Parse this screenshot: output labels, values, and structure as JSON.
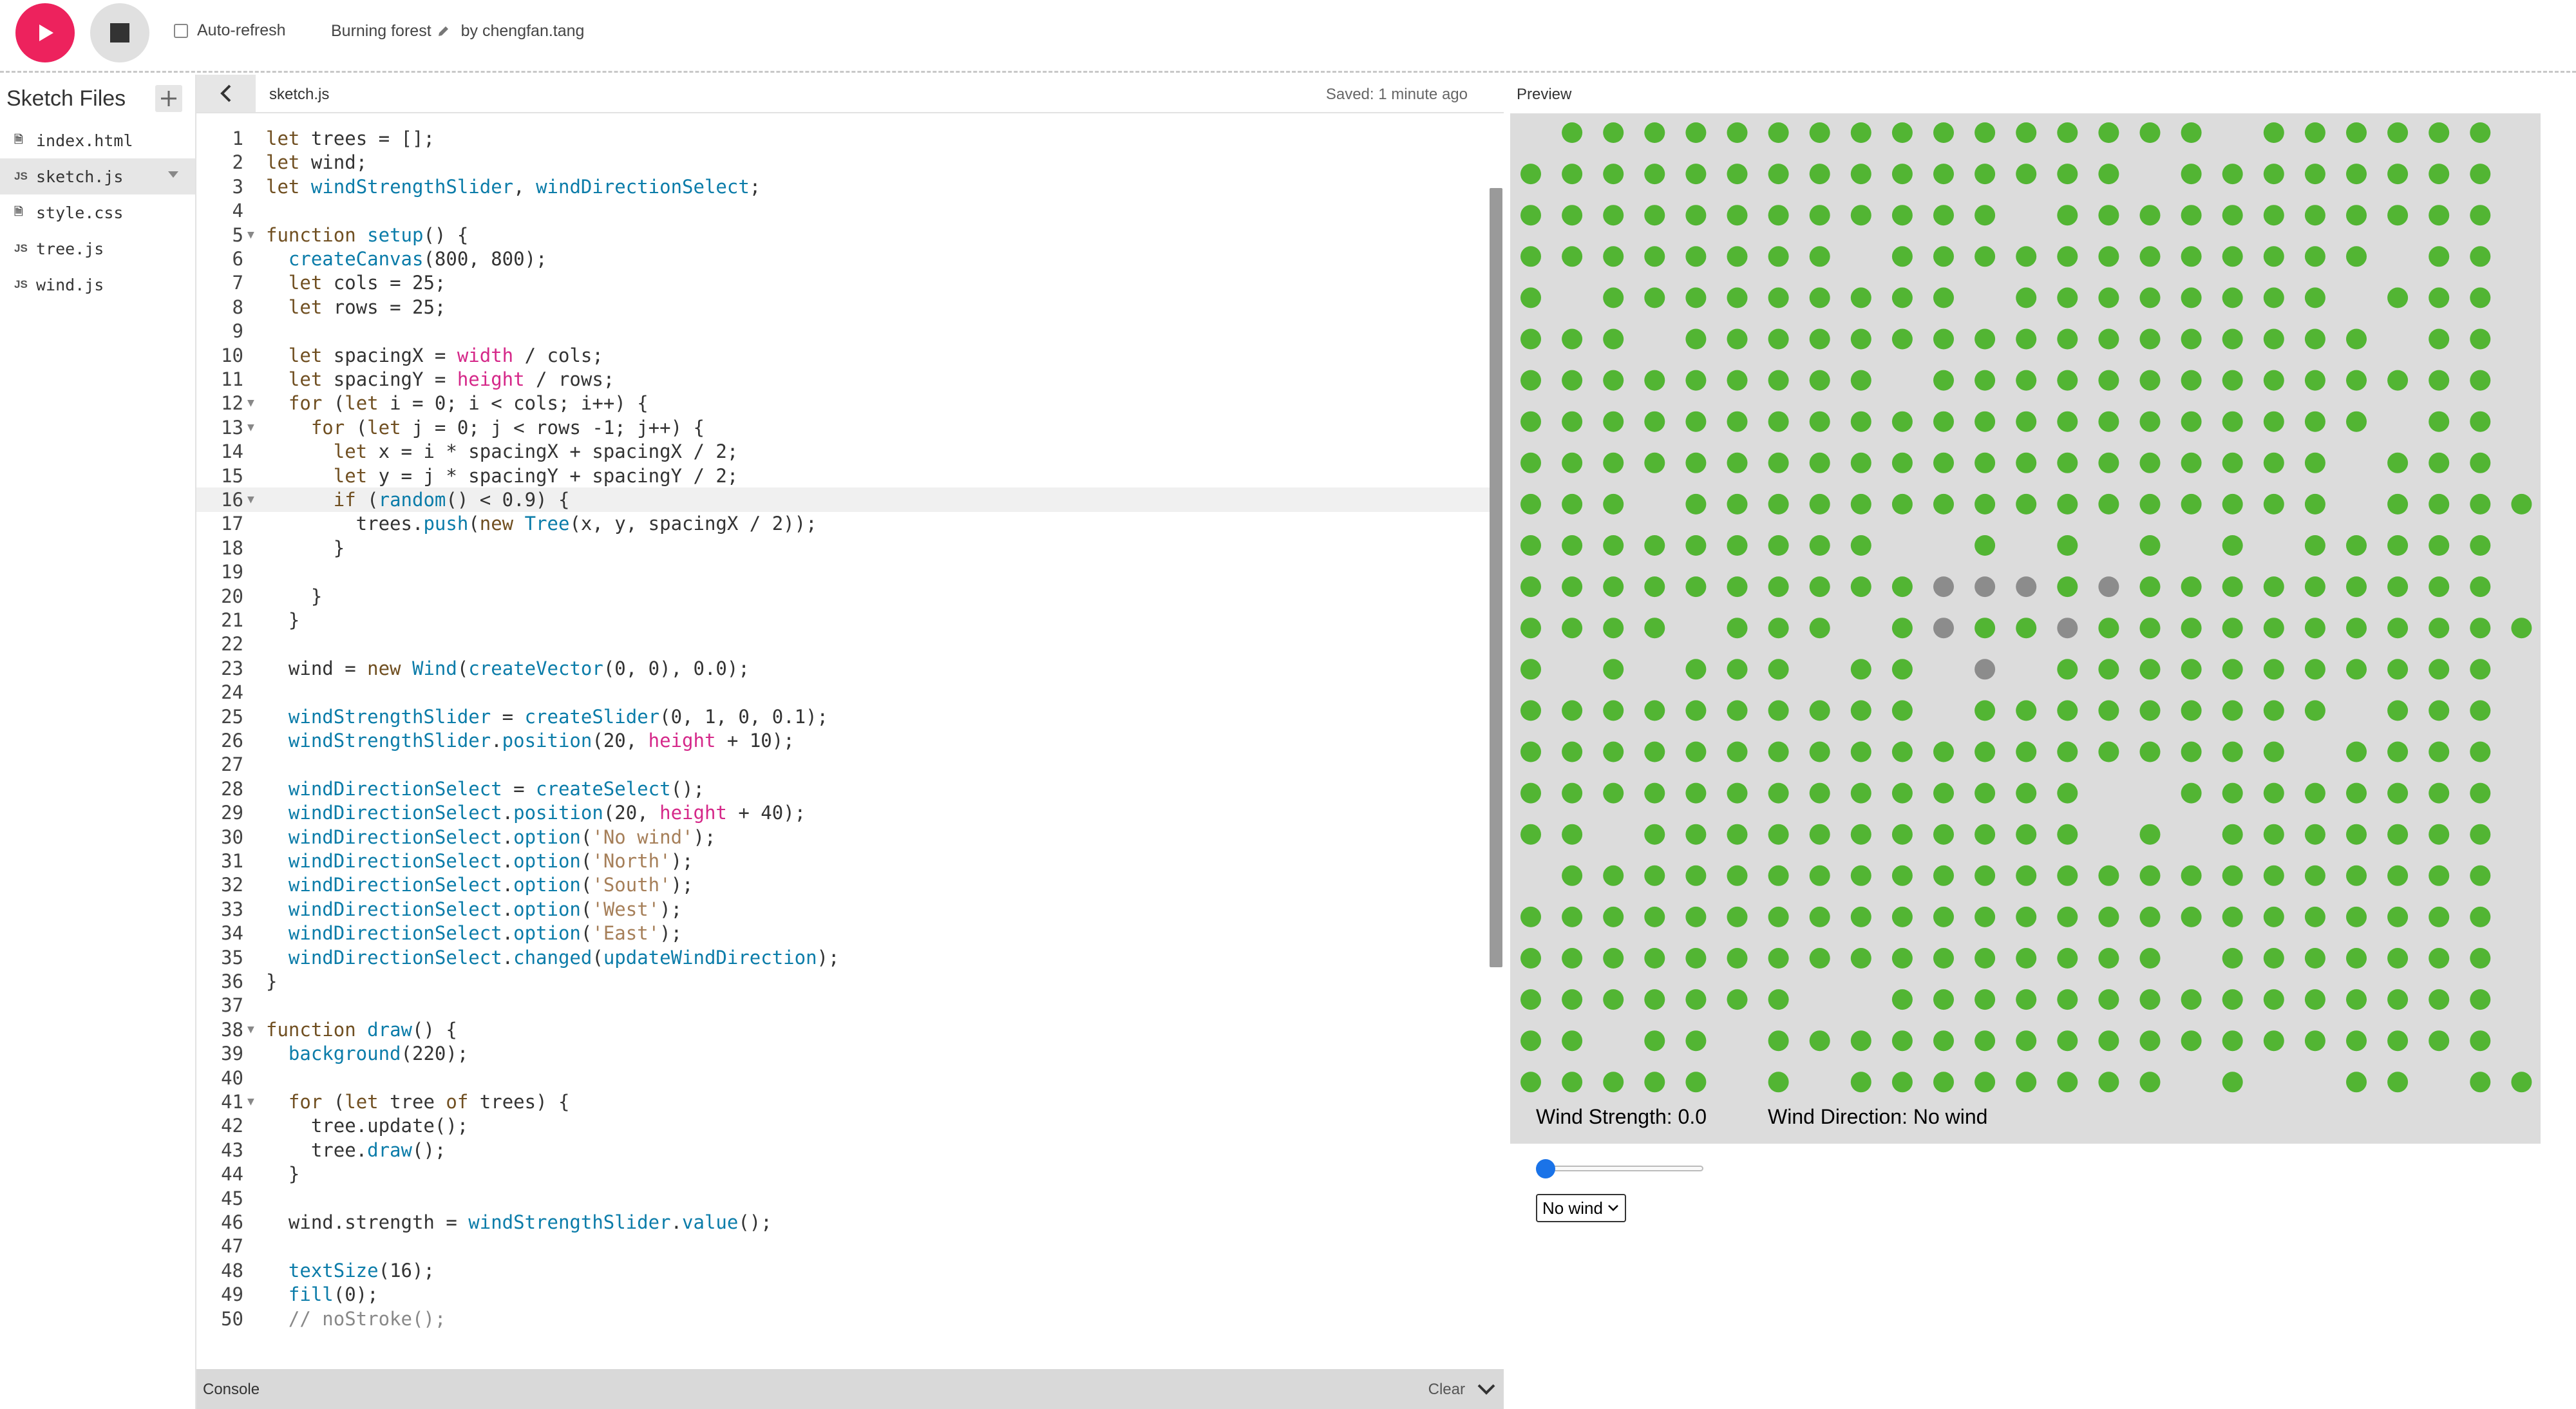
{
  "toolbar": {
    "autorefresh_label": "Auto-refresh",
    "sketch_name": "Burning forest",
    "byline": "by chengfan.tang"
  },
  "sidebar": {
    "title": "Sketch Files",
    "files": [
      {
        "name": "index.html",
        "icon": "html-file-icon"
      },
      {
        "name": "sketch.js",
        "icon": "js-file-icon",
        "active": true
      },
      {
        "name": "style.css",
        "icon": "css-file-icon"
      },
      {
        "name": "tree.js",
        "icon": "js-file-icon"
      },
      {
        "name": "wind.js",
        "icon": "js-file-icon"
      }
    ]
  },
  "editor": {
    "tab": "sketch.js",
    "saved": "Saved: 1 minute ago",
    "lines": [
      "let trees = [];",
      "let wind;",
      "let windStrengthSlider, windDirectionSelect;",
      "",
      "function setup() {",
      "  createCanvas(800, 800);",
      "  let cols = 25;",
      "  let rows = 25;",
      "",
      "  let spacingX = width / cols;",
      "  let spacingY = height / rows;",
      "  for (let i = 0; i < cols; i++) {",
      "    for (let j = 0; j < rows -1; j++) {",
      "      let x = i * spacingX + spacingX / 2;",
      "      let y = j * spacingY + spacingY / 2;",
      "      if (random() < 0.9) {",
      "        trees.push(new Tree(x, y, spacingX / 2));",
      "      }",
      "",
      "    }",
      "  }",
      "",
      "  wind = new Wind(createVector(0, 0), 0.0);",
      "",
      "  windStrengthSlider = createSlider(0, 1, 0, 0.1);",
      "  windStrengthSlider.position(20, height + 10);",
      "",
      "  windDirectionSelect = createSelect();",
      "  windDirectionSelect.position(20, height + 40);",
      "  windDirectionSelect.option('No wind');",
      "  windDirectionSelect.option('North');",
      "  windDirectionSelect.option('South');",
      "  windDirectionSelect.option('West');",
      "  windDirectionSelect.option('East');",
      "  windDirectionSelect.changed(updateWindDirection);",
      "}",
      "",
      "function draw() {",
      "  background(220);",
      "",
      "  for (let tree of trees) {",
      "    tree.update();",
      "    tree.draw();",
      "  }",
      "",
      "  wind.strength = windStrengthSlider.value();",
      "",
      "  textSize(16);",
      "  fill(0);",
      "  // noStroke();"
    ],
    "fold_lines": [
      5,
      12,
      13,
      16,
      38,
      41
    ],
    "highlight_line": 16,
    "console_label": "Console",
    "clear_label": "Clear"
  },
  "preview": {
    "label": "Preview",
    "wind_strength_text": "Wind Strength: 0.0",
    "wind_direction_text": "Wind Direction: No wind",
    "slider_value": 0.0,
    "select_value": "No wind",
    "colors": {
      "tree": "#52b533",
      "burnt": "#8c8c8c",
      "background": "#dcdcdc"
    },
    "forest": [
      ".GGGGGGGGGGGGGGGG.GGGGGG",
      "GGGGGGGGGGGGGGG.GGGGGGGG",
      "GGGGGGGGGGGG.GGGGGGGGGGG",
      "GGGGGGGG.GGGGGGGGGGGG.GG",
      "G.GGGGGGGGG.GGGGGGGG.GGG",
      "GGG.GGGGGGGGGGGGGGGGG.GG",
      "GGGGGGGGG.GGGGGGGGGGGGGG",
      "GGGGGGGGGGGGGGGGGGGGG.GG",
      "GGGGGGGGGGGGGGGGGGGG.GGG",
      "GGG.GGGGGGGGGGGGGGGG.GGGG",
      "GGGGGGGGG..G.G.G.G.GGGGG",
      "GGGGGGGGGGBBBGBGGGGGGGGG",
      "GGGG.GGG.GBGGBGGGGGGGGGGG",
      "G.G.GGG.GG.B.GGGGGGGGGGG",
      "GGGGGGGGGG.GGGGGGGGG.GGG",
      "GGGGGGGGGGGGGGGGGGG.GGGG",
      "GGGGGGGGGGGGGG..GGGGGGGG",
      "GG.GGGGGGGGGGG.G.GGGGGGG",
      ".GGGGGGGGGGGGGGGGGGGGGGG",
      "GGGGGGGGGGGGGGGGGGGGGGGG",
      "GGGGGGGGGGGGGGGG.GGGGGGG",
      "GGGGGGG..GGGGGGGGGGGGGGG",
      "GG.GG.GGGGGGGGGGGGGGGGGG",
      "GGGGG.G.GGGGGGGG.G..GG.GG"
    ]
  }
}
